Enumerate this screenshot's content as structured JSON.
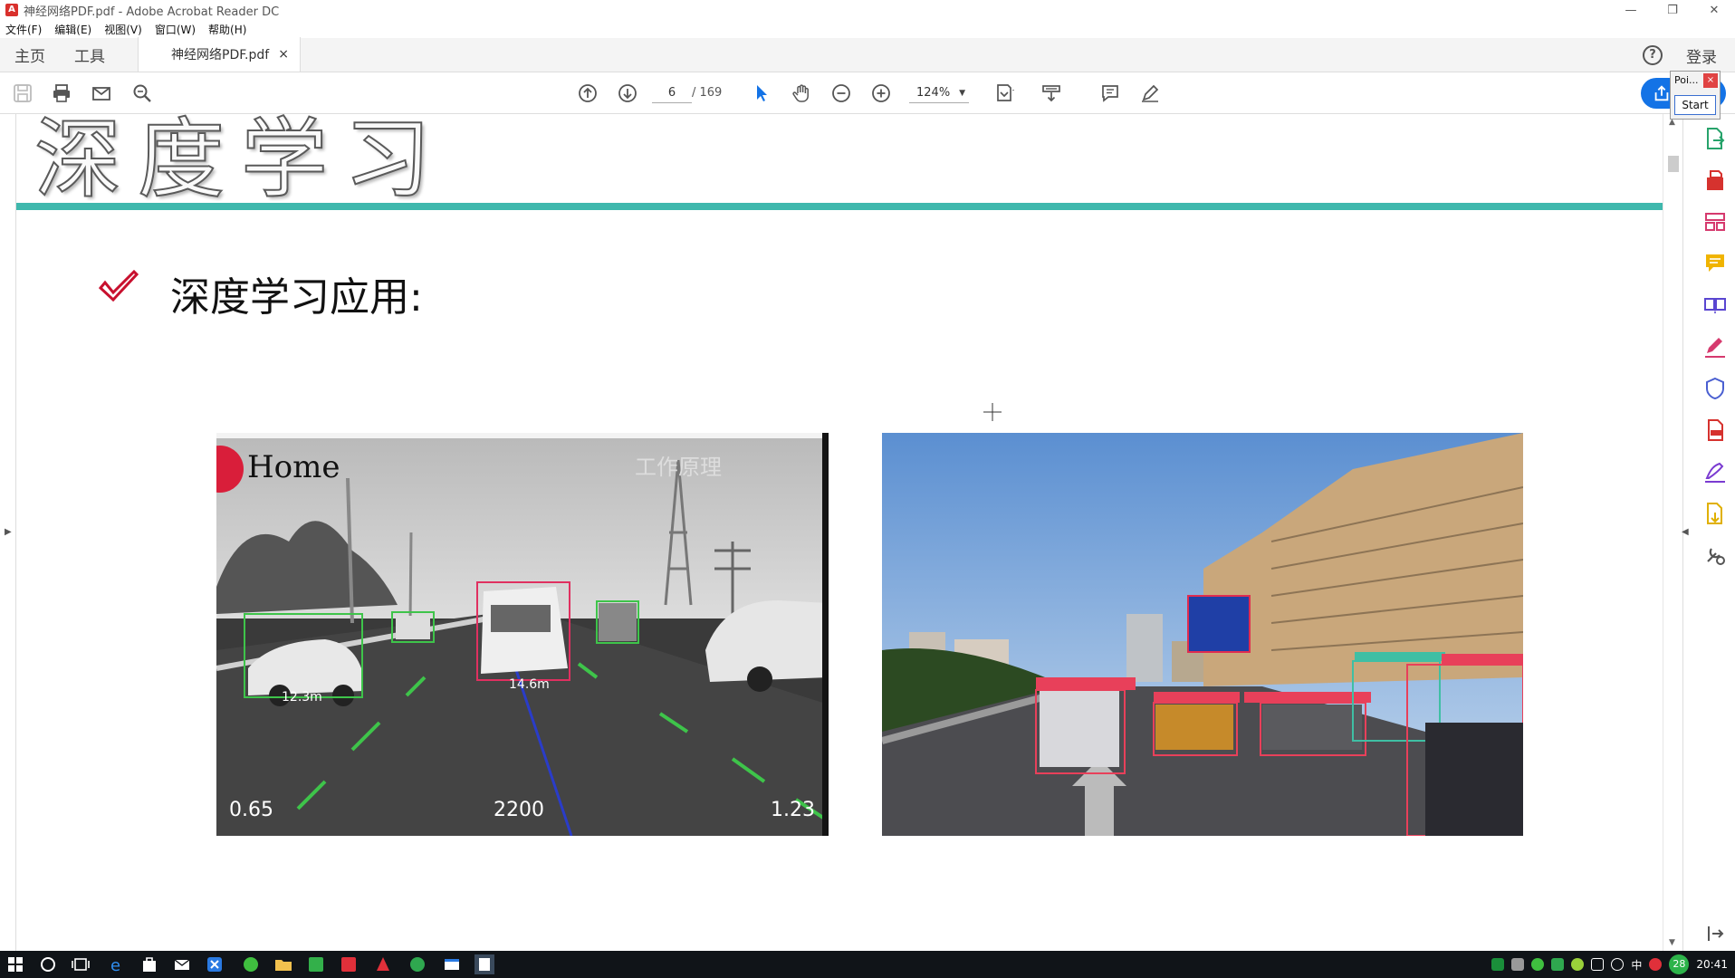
{
  "window": {
    "title": "神经网络PDF.pdf - Adobe Acrobat Reader DC",
    "controls": {
      "minimize": "—",
      "restore": "❐",
      "close": "✕"
    }
  },
  "menu": [
    "文件(F)",
    "编辑(E)",
    "视图(V)",
    "窗口(W)",
    "帮助(H)"
  ],
  "tabs": {
    "home": "主页",
    "tools": "工具",
    "document": "神经网络PDF.pdf",
    "close_glyph": "×",
    "login": "登录",
    "help_glyph": "?"
  },
  "toolbar": {
    "page_current": "6",
    "page_total": "/ 169",
    "zoom": "124%",
    "icons": [
      "save-icon",
      "print-icon",
      "email-icon",
      "search-icon",
      "page-up-icon",
      "page-down-icon",
      "select-cursor-icon",
      "hand-icon",
      "zoom-out-icon",
      "zoom-in-icon",
      "fit-page-icon",
      "scroll-mode-icon",
      "comment-icon",
      "pen-icon",
      "share-icon"
    ]
  },
  "mini_window": {
    "title": "Poi...",
    "close": "×",
    "start": "Start"
  },
  "document": {
    "heading": "深度学习",
    "bullet": "深度学习应用:",
    "left_photo": {
      "logo": "Home",
      "watermark": "工作原理",
      "distance_car": "12.3m",
      "distance_lead": "14.6m",
      "bottom_left": "0.65",
      "bottom_center": "2200",
      "bottom_right": "1.23"
    }
  },
  "right_panel_icons": [
    "export-pdf-icon",
    "create-pdf-icon",
    "organize-pages-icon",
    "comment-icon",
    "combine-files-icon",
    "fill-sign-icon",
    "protect-icon",
    "pdf-edit-icon",
    "sign-icon",
    "more-tools-icon",
    "tools-settings-icon"
  ],
  "taskbar": {
    "time": "20:41",
    "ime": "中",
    "notif_count": "28"
  },
  "colors": {
    "teal_rule": "#3fb8ad",
    "check_red": "#c8102e",
    "acrobat_blue": "#1473e6",
    "taskbar": "#101418"
  }
}
